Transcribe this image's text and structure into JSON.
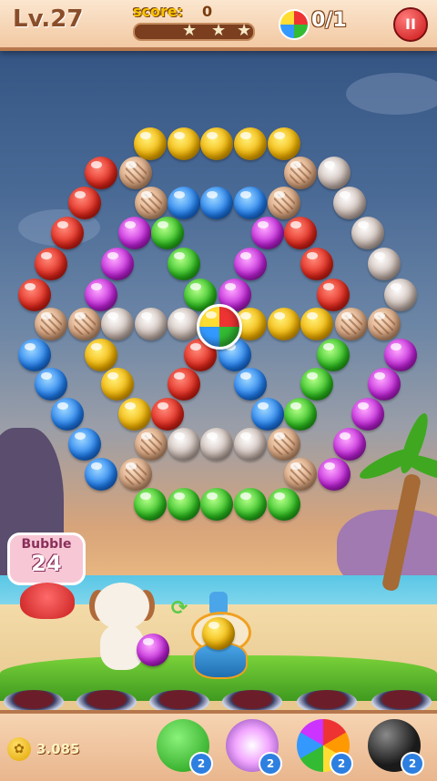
{
  "header": {
    "level_label": "Lv.27",
    "score_label": "score:",
    "score_value": "0",
    "score_progress": 0.0,
    "target_text": "0/1",
    "pause_label": "II"
  },
  "board": {
    "rows": [
      [
        "yellow",
        "yellow",
        "yellow",
        "yellow",
        "yellow"
      ],
      [
        "red",
        "shell",
        "shell",
        "silver"
      ],
      [
        "red",
        "shell",
        "blue",
        "blue",
        "blue",
        "shell",
        "silver"
      ],
      [
        "red",
        "purple",
        "green",
        "purple",
        "red",
        "silver"
      ],
      [
        "red",
        "purple",
        "green",
        "purple",
        "red",
        "silver"
      ],
      [
        "red",
        "purple",
        "green",
        "purple",
        "red",
        "silver"
      ],
      [
        "shell",
        "shell",
        "silver",
        "silver",
        "silver",
        "yellow",
        "yellow",
        "yellow",
        "shell",
        "shell"
      ],
      [
        "blue",
        "yellow",
        "red",
        "blue",
        "green",
        "purple"
      ],
      [
        "blue",
        "yellow",
        "red",
        "blue",
        "green",
        "purple"
      ],
      [
        "blue",
        "yellow",
        "red",
        "blue",
        "green",
        "purple"
      ],
      [
        "blue",
        "shell",
        "silver",
        "silver",
        "silver",
        "shell",
        "purple"
      ],
      [
        "blue",
        "shell",
        "shell",
        "purple"
      ],
      [
        "green",
        "green",
        "green",
        "green",
        "green"
      ]
    ],
    "center_item": "rainbow-target"
  },
  "sign": {
    "title": "Bubble",
    "count": "24"
  },
  "launcher": {
    "current_bubble": "yellow",
    "next_bubble": "purple"
  },
  "footer": {
    "coins": "3.085",
    "tools": [
      {
        "name": "aim-line",
        "count": "2"
      },
      {
        "name": "light-ball",
        "count": "2"
      },
      {
        "name": "rainbow-ball",
        "count": "2"
      },
      {
        "name": "bomb-ball",
        "count": "2"
      }
    ]
  },
  "colors": {
    "yellow": "#f3b300",
    "red": "#e1261a",
    "blue": "#1f7ef0",
    "green": "#2bbd1e",
    "purple": "#c021d9",
    "silver": "#c9b8b0",
    "shell": "#d6a27c"
  }
}
